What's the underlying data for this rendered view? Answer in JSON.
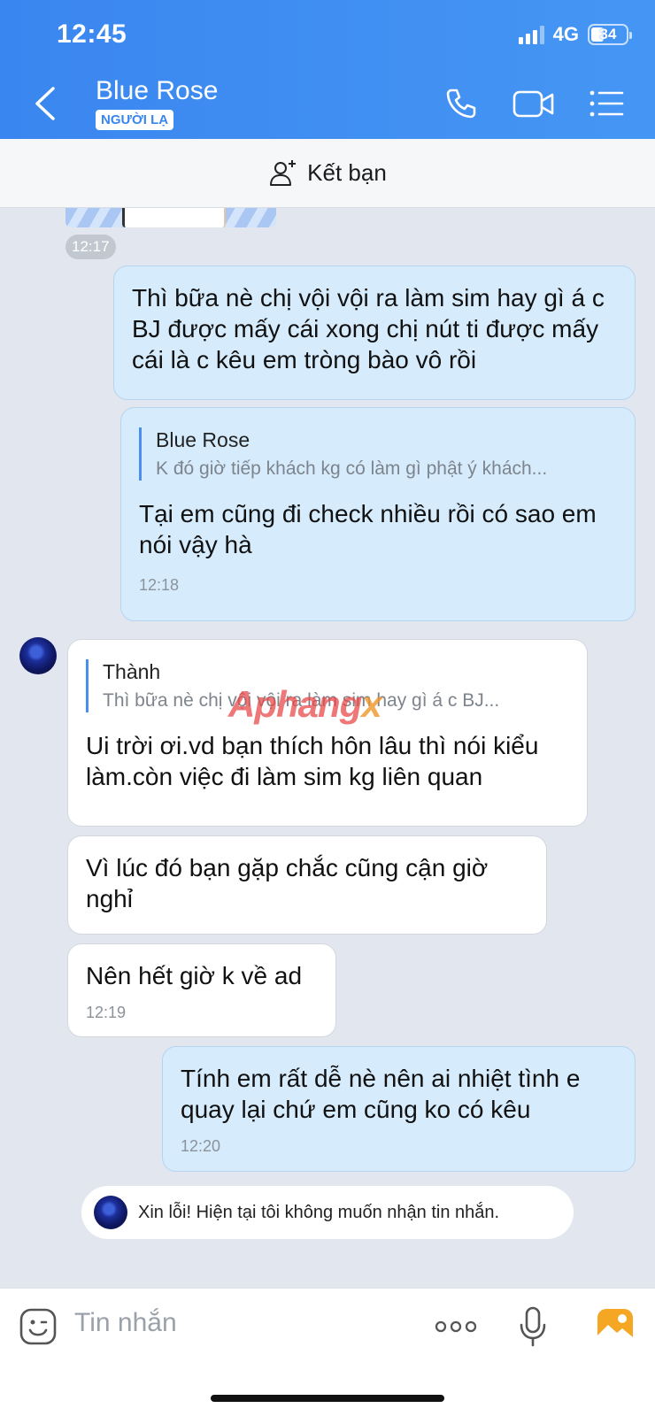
{
  "status_bar": {
    "time": "12:45",
    "network": "4G",
    "battery": "34"
  },
  "header": {
    "contact_name": "Blue Rose",
    "badge": "NGƯỜI LẠ"
  },
  "friend_bar": {
    "label": "Kết bạn"
  },
  "messages": {
    "image_time": "12:17",
    "m1": {
      "text": "Thì bữa nè chị vội vội ra làm sim hay gì á c BJ được mấy cái xong chị nút ti được mấy cái là c kêu em tròng bào vô rồi"
    },
    "m2": {
      "quote_author": "Blue Rose",
      "quote_text": "K đó giờ tiếp khách kg có làm gì phật ý khách...",
      "text": "Tại em cũng đi check nhiều rồi có sao em nói vậy hà",
      "time": "12:18"
    },
    "m3": {
      "quote_author": "Thành",
      "quote_text": "Thì bữa nè chị vội vội ra làm sim hay gì á c BJ...",
      "text": "Ui trời ơi.vd bạn thích hôn lâu thì nói kiểu làm.còn việc đi làm sim kg liên quan"
    },
    "m4": {
      "text": "Vì lúc đó bạn gặp chắc cũng cận giờ nghỉ"
    },
    "m5": {
      "text": "Nên hết giờ k về ad",
      "time": "12:19"
    },
    "m6": {
      "text": "Tính em rất dễ nè nên ai nhiệt tình e quay lại chứ em cũng ko có kêu",
      "time": "12:20"
    }
  },
  "watermark": {
    "part1": "Aphang",
    "part2": "x"
  },
  "notice": {
    "text": "Xin lỗi! Hiện tại tôi không muốn nhận tin nhắn."
  },
  "input": {
    "placeholder": "Tin nhắn"
  },
  "icons": {
    "back": "chevron-left-icon",
    "call": "phone-icon",
    "video": "video-camera-icon",
    "menu": "list-menu-icon",
    "add_friend": "add-user-icon",
    "emoji": "emoji-icon",
    "more": "more-dots-icon",
    "mic": "microphone-icon",
    "gallery": "gallery-icon"
  },
  "colors": {
    "header": "#3a86f0",
    "outgoing_bubble": "#d6ecfd",
    "incoming_bubble": "#ffffff",
    "background": "#e2e7ef",
    "accent": "#4a8ff0"
  }
}
